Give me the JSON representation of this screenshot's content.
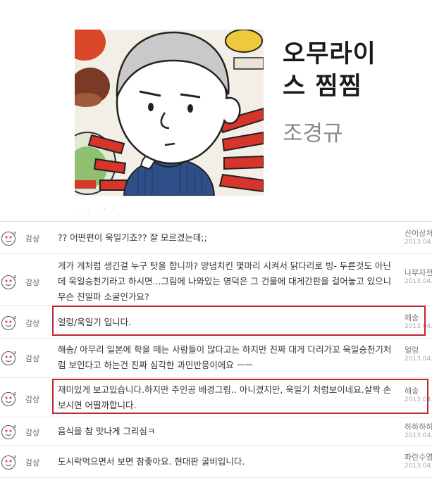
{
  "book": {
    "title_line1": "오무라이",
    "title_line2": "스 찜찜",
    "author": "조경규",
    "dots": ". . · · ·"
  },
  "comments": [
    {
      "grade": "감상",
      "text": "?? 어떤편이 욱일기죠?? 잘 모르겠는데;;",
      "user": "산이상처",
      "date": "2013.04.2",
      "highlighted": false
    },
    {
      "grade": "감상",
      "text": "게가 게처럼 생긴걸 누구 탓을 합니까? 양념치킨 몇마리 시켜서 닭다리로 빙- 두른것도 아닌데 욱일승천기라고 하시면...그림에 나와있는 영덕은 그 건물에 대게간판을 걸어놓고 있으니 무슨 친일파 소굴인가요?",
      "user": "나무자전",
      "date": "2013.04.2",
      "highlighted": false
    },
    {
      "grade": "감상",
      "text": "얼렁/욱일기 입니다.",
      "user": "해송",
      "date": "2013.04.2",
      "highlighted": true
    },
    {
      "grade": "감상",
      "text": "해송/ 아무리 일본에 학을 떼는 사람들이 많다고는 하지만 진짜 대게 다리가꼬 욱일승천기처럼 보인다고 하는건 진짜 심각한 과민반응이에요 ㅡㅡ",
      "user": "얼렁",
      "date": "2013.04.2",
      "highlighted": false
    },
    {
      "grade": "감상",
      "text": "재미있게 보고있습니다.하지만 주인공 배경그림.. 아니겠지만, 욱일기 처럼보이네요.살짝 손보시면 어떨까합니다.",
      "user": "해송",
      "date": "2013.04.2",
      "highlighted": true
    },
    {
      "grade": "감상",
      "text": "음식을 참 맛나게 그리심ㅋ",
      "user": "하하하하",
      "date": "2013.04.2",
      "highlighted": false
    },
    {
      "grade": "감상",
      "text": "도시락먹으면서 보면 참좋아요. 현대판 굴비입니다.",
      "user": "파란수염",
      "date": "2013.04.2",
      "highlighted": false
    }
  ],
  "colors": {
    "highlight": "#c0282e",
    "face": "#d9506a",
    "title": "#1a1a1a",
    "author": "#8a8a8a"
  }
}
